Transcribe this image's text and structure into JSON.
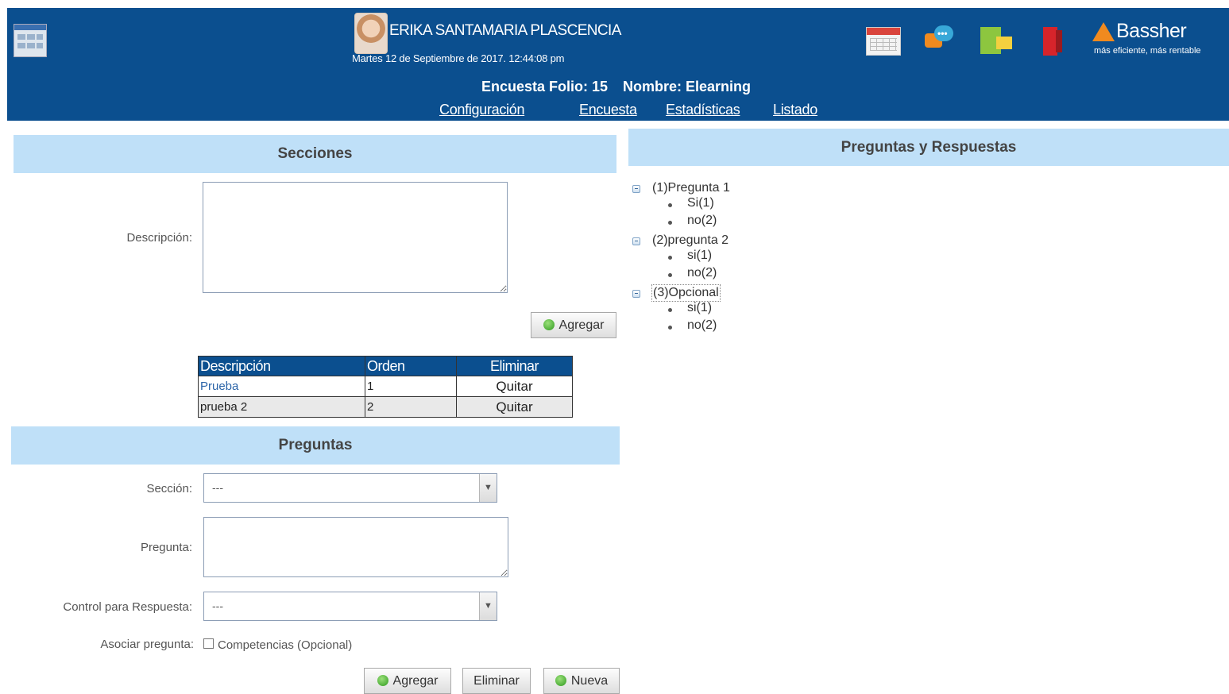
{
  "header": {
    "user_name": "ERIKA SANTAMARIA PLASCENCIA",
    "date": "Martes 12 de Septiembre de 2017. 12:44:08 pm",
    "folio": "Encuesta Folio: 15",
    "nombre": "Nombre: Elearning",
    "nav": [
      "Configuración",
      "Encuesta",
      "Estadísticas",
      "Listado"
    ],
    "logo_name": "Bassher",
    "logo_tagline": "más eficiente, más rentable",
    "icons": [
      "app-grid-icon",
      "calendar-icon",
      "chat-icon",
      "notes-icon",
      "exit-door-icon"
    ],
    "brand_color": "#0b4f8f",
    "accent_color": "#f08a1f"
  },
  "secciones": {
    "title": "Secciones",
    "descripcion_label": "Descripción:",
    "descripcion_value": "",
    "agregar_label": "Agregar",
    "table": {
      "headers": [
        "Descripción",
        "Orden",
        "Eliminar"
      ],
      "rows": [
        {
          "descripcion": "Prueba",
          "orden": "1",
          "eliminar": "Quitar"
        },
        {
          "descripcion": "prueba 2",
          "orden": "2",
          "eliminar": "Quitar"
        }
      ]
    }
  },
  "preguntas": {
    "title": "Preguntas",
    "seccion_label": "Sección:",
    "seccion_value": "---",
    "pregunta_label": "Pregunta:",
    "pregunta_value": "",
    "control_label": "Control para Respuesta:",
    "control_value": "---",
    "asociar_label": "Asociar pregunta:",
    "competencias_label": "Competencias (Opcional)",
    "competencias_checked": false,
    "buttons": {
      "agregar": "Agregar",
      "eliminar": "Eliminar",
      "nueva": "Nueva"
    }
  },
  "respuestas": {
    "title": "Preguntas y Respuestas",
    "tree": [
      {
        "question": "(1)Pregunta 1",
        "answers": [
          "Si(1)",
          "no(2)"
        ]
      },
      {
        "question": "(2)pregunta 2",
        "answers": [
          "si(1)",
          "no(2)"
        ]
      },
      {
        "question": "(3)Opcional",
        "answers": [
          "si(1)",
          "no(2)"
        ],
        "selected": true
      }
    ]
  }
}
